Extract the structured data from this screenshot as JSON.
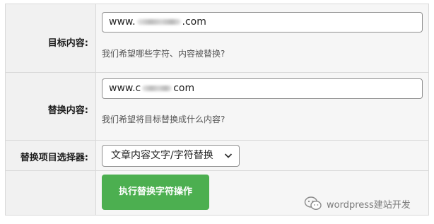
{
  "form": {
    "target": {
      "label": "目标内容:",
      "value_prefix": "www.",
      "value_suffix": ".com",
      "hint": "我们希望哪些字符、内容被替换?"
    },
    "replace": {
      "label": "替换内容:",
      "value_prefix": "www.c",
      "value_suffix": "com",
      "hint": "我们希望将目标替换成什么内容?"
    },
    "selector": {
      "label": "替换项目选择器:",
      "selected": "文章内容文字/字符替换"
    },
    "submit_label": "执行替换字符操作"
  },
  "watermark": {
    "text": "wordpress建站开发"
  },
  "colors": {
    "button": "#4caf50",
    "border": "#d9d9d9",
    "background": "#f6f6f6"
  },
  "icons": {
    "select_arrow": "chevron-down-icon",
    "watermark_logo": "wechat-icon"
  }
}
